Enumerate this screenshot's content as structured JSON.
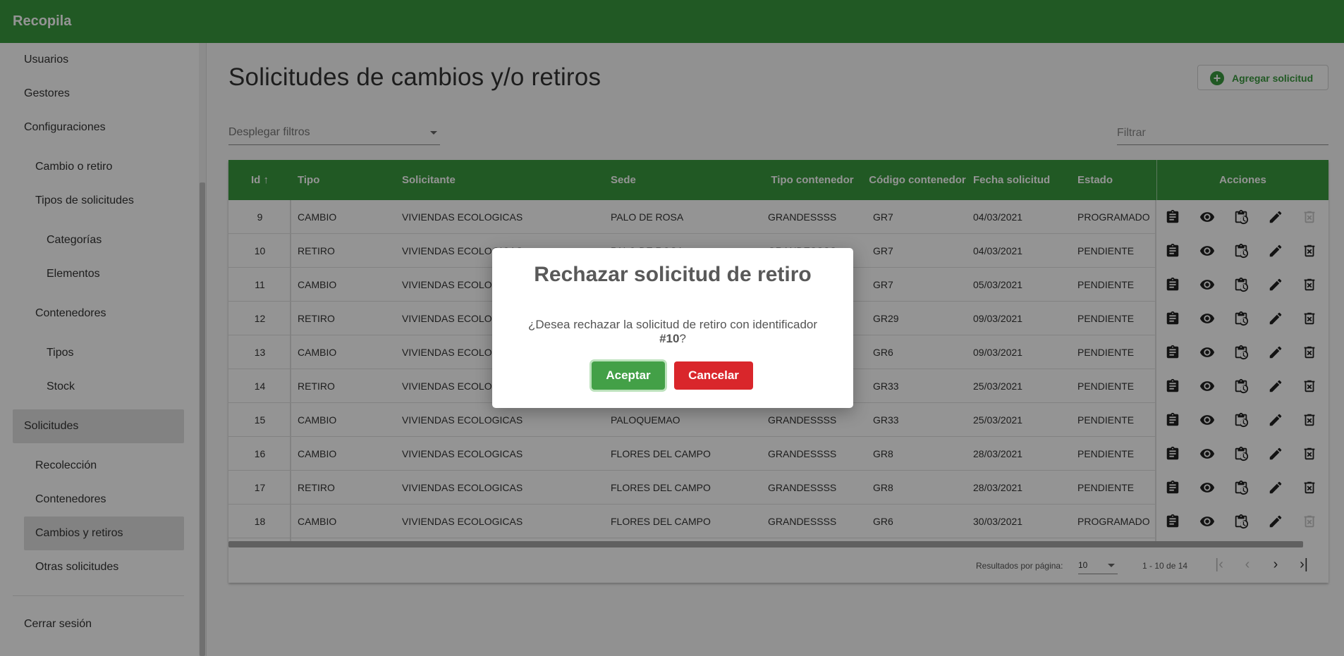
{
  "app": {
    "title": "Recopila"
  },
  "sidebar": {
    "items": [
      {
        "label": "Usuarios"
      },
      {
        "label": "Gestores"
      },
      {
        "label": "Configuraciones"
      },
      {
        "label": "Cambio o retiro"
      },
      {
        "label": "Tipos de solicitudes"
      },
      {
        "label": "Categorías"
      },
      {
        "label": "Elementos"
      },
      {
        "label": "Contenedores"
      },
      {
        "label": "Tipos"
      },
      {
        "label": "Stock"
      },
      {
        "label": "Solicitudes"
      },
      {
        "label": "Recolección"
      },
      {
        "label": "Contenedores"
      },
      {
        "label": "Cambios y retiros"
      },
      {
        "label": "Otras solicitudes"
      },
      {
        "label": "Cerrar sesión"
      }
    ]
  },
  "page": {
    "title": "Solicitudes de cambios y/o retiros",
    "add_button": "Agregar solicitud",
    "filters_select": "Desplegar filtros",
    "filter_placeholder": "Filtrar"
  },
  "table": {
    "headers": {
      "id": "Id ↑",
      "tipo": "Tipo",
      "solicitante": "Solicitante",
      "sede": "Sede",
      "tipo_contenedor": "Tipo contenedor",
      "codigo_contenedor": "Código contenedor",
      "fecha": "Fecha solicitud",
      "estado": "Estado",
      "acciones": "Acciones"
    },
    "rows": [
      {
        "id": "9",
        "tipo": "CAMBIO",
        "solicitante": "VIVIENDAS ECOLOGICAS",
        "sede": "PALO DE ROSA",
        "tipo_contenedor": "GRANDESSSS",
        "codigo": "GR7",
        "fecha": "04/03/2021",
        "estado": "PROGRAMADO",
        "delete_enabled": false
      },
      {
        "id": "10",
        "tipo": "RETIRO",
        "solicitante": "VIVIENDAS ECOLOGICAS",
        "sede": "PALO DE ROSA",
        "tipo_contenedor": "GRANDESSSS",
        "codigo": "GR7",
        "fecha": "04/03/2021",
        "estado": "PENDIENTE",
        "delete_enabled": true
      },
      {
        "id": "11",
        "tipo": "CAMBIO",
        "solicitante": "VIVIENDAS ECOLOGICAS",
        "sede": "",
        "tipo_contenedor": "",
        "codigo": "GR7",
        "fecha": "05/03/2021",
        "estado": "PENDIENTE",
        "delete_enabled": true
      },
      {
        "id": "12",
        "tipo": "RETIRO",
        "solicitante": "VIVIENDAS ECOLOGICAS",
        "sede": "",
        "tipo_contenedor": "",
        "codigo": "GR29",
        "fecha": "09/03/2021",
        "estado": "PENDIENTE",
        "delete_enabled": true
      },
      {
        "id": "13",
        "tipo": "CAMBIO",
        "solicitante": "VIVIENDAS ECOLOGICAS",
        "sede": "",
        "tipo_contenedor": "",
        "codigo": "GR6",
        "fecha": "09/03/2021",
        "estado": "PENDIENTE",
        "delete_enabled": true
      },
      {
        "id": "14",
        "tipo": "RETIRO",
        "solicitante": "VIVIENDAS ECOLOGICAS",
        "sede": "",
        "tipo_contenedor": "",
        "codigo": "GR33",
        "fecha": "25/03/2021",
        "estado": "PENDIENTE",
        "delete_enabled": true
      },
      {
        "id": "15",
        "tipo": "CAMBIO",
        "solicitante": "VIVIENDAS ECOLOGICAS",
        "sede": "PALOQUEMAO",
        "tipo_contenedor": "GRANDESSSS",
        "codigo": "GR33",
        "fecha": "25/03/2021",
        "estado": "PENDIENTE",
        "delete_enabled": true
      },
      {
        "id": "16",
        "tipo": "CAMBIO",
        "solicitante": "VIVIENDAS ECOLOGICAS",
        "sede": "FLORES DEL CAMPO",
        "tipo_contenedor": "GRANDESSSS",
        "codigo": "GR8",
        "fecha": "28/03/2021",
        "estado": "PENDIENTE",
        "delete_enabled": true
      },
      {
        "id": "17",
        "tipo": "RETIRO",
        "solicitante": "VIVIENDAS ECOLOGICAS",
        "sede": "FLORES DEL CAMPO",
        "tipo_contenedor": "GRANDESSSS",
        "codigo": "GR8",
        "fecha": "28/03/2021",
        "estado": "PENDIENTE",
        "delete_enabled": true
      },
      {
        "id": "18",
        "tipo": "CAMBIO",
        "solicitante": "VIVIENDAS ECOLOGICAS",
        "sede": "FLORES DEL CAMPO",
        "tipo_contenedor": "GRANDESSSS",
        "codigo": "GR6",
        "fecha": "30/03/2021",
        "estado": "PROGRAMADO",
        "delete_enabled": false
      }
    ]
  },
  "paginator": {
    "label": "Resultados por página:",
    "page_size": "10",
    "range": "1 - 10 de 14"
  },
  "dialog": {
    "title": "Rechazar solicitud de retiro",
    "text_before": "¿Desea rechazar la solicitud de retiro con identificador ",
    "id": "#10",
    "text_after": "?",
    "accept": "Aceptar",
    "cancel": "Cancelar"
  },
  "colors": {
    "primary": "#3a9a3e",
    "accept": "#43a047",
    "cancel": "#d9262b",
    "overlay": "rgba(0,0,0,0.42)"
  },
  "icons": [
    "clipboard-icon",
    "eye-icon",
    "clipboard-clock-icon",
    "pencil-icon",
    "delete-box-icon"
  ]
}
